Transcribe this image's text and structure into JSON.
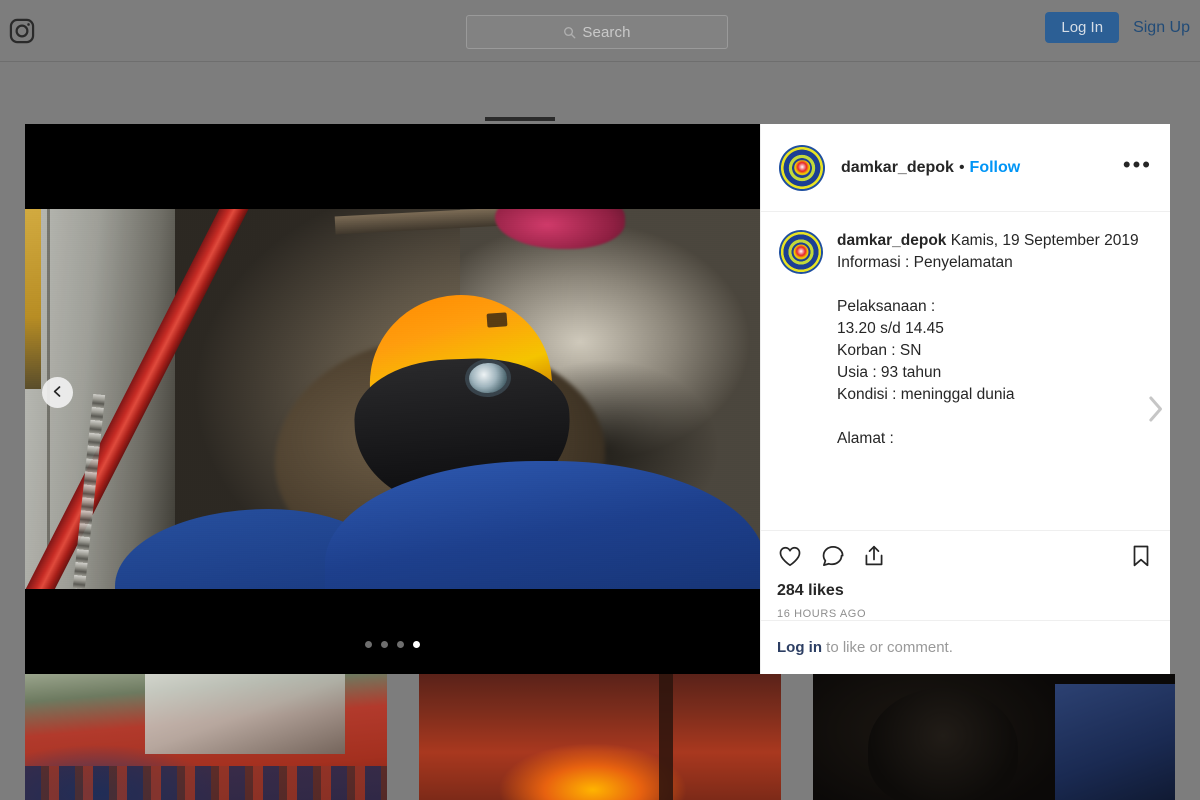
{
  "nav": {
    "logo_icon": "instagram-camera-icon",
    "search": {
      "placeholder": "Search",
      "value": "",
      "icon": "search-icon"
    },
    "login_label": "Log In",
    "signup_label": "Sign Up"
  },
  "post": {
    "header": {
      "username": "damkar_depok",
      "separator": "•",
      "follow_label": "Follow",
      "more_options_label": "•••",
      "avatar_name": "damkar-depok-avatar"
    },
    "caption": {
      "username": "damkar_depok",
      "text": "Kamis, 19 September 2019\nInformasi : Penyelamatan\n\nPelaksanaan :\n13.20 s/d 14.45\nKorban : SN\nUsia : 93 tahun\nKondisi : meninggal dunia\n\nAlamat :"
    },
    "actions": {
      "like_icon": "heart-icon",
      "comment_icon": "comment-bubble-icon",
      "share_icon": "share-arrow-icon",
      "bookmark_icon": "bookmark-icon"
    },
    "likes_text": "284 likes",
    "timestamp": "16 HOURS AGO",
    "comment_prompt": {
      "login_label": "Log in",
      "rest": " to like or comment."
    },
    "carousel": {
      "prev_icon": "chevron-left-icon",
      "next_icon": "chevron-right-icon",
      "total_slides": 4,
      "active_slide": 4
    }
  },
  "thumbnails": [
    {
      "name": "thumbnail-fire-truck-crew"
    },
    {
      "name": "thumbnail-building-fire"
    },
    {
      "name": "thumbnail-rescue-people"
    }
  ],
  "colors": {
    "overlay": "#7d7d7d",
    "login_button_bg": "#2c5f95",
    "follow_link": "#0095f6",
    "text_primary": "#262626",
    "text_muted": "#8e8e8e"
  }
}
